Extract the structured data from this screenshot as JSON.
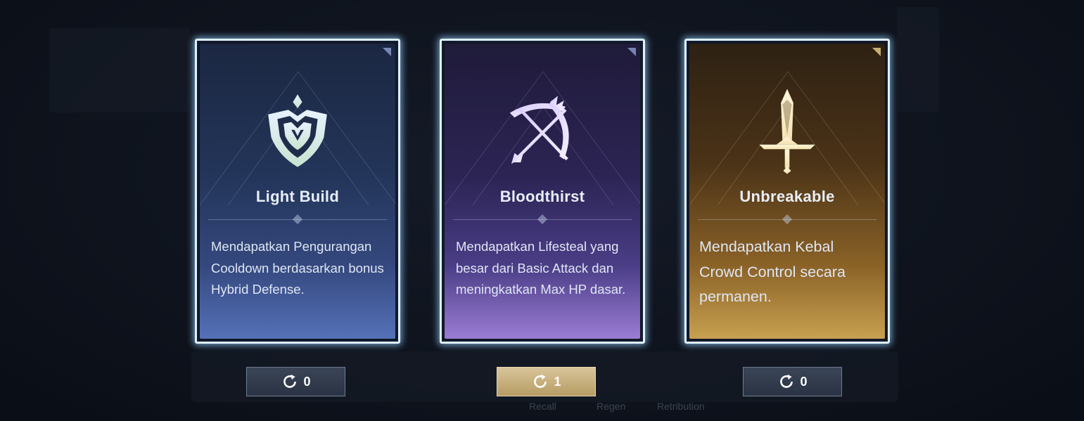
{
  "cards": [
    {
      "title": "Light Build",
      "description": "Mendapatkan Pengurangan Cooldown berdasarkan bonus Hybrid Defense.",
      "icon": "shield-icon",
      "theme": "#3a5290"
    },
    {
      "title": "Bloodthirst",
      "description": "Mendapatkan Lifesteal yang besar dari Basic Attack dan meningkatkan Max HP dasar.",
      "icon": "crossed-bow-arrow-icon",
      "theme": "#6b55b0"
    },
    {
      "title": "Unbreakable",
      "description": "Mendapatkan Kebal Crowd Control secara permanen.",
      "icon": "sword-icon",
      "theme": "#a77d3a"
    }
  ],
  "rerolls": [
    {
      "count": "0",
      "icon": "refresh-icon",
      "highlighted": false
    },
    {
      "count": "1",
      "icon": "refresh-icon",
      "highlighted": true
    },
    {
      "count": "0",
      "icon": "refresh-icon",
      "highlighted": false
    }
  ],
  "background": {
    "labels": [
      "Recall",
      "Regen",
      "Retribution"
    ]
  },
  "colors": {
    "card_border": "#dff1ff",
    "reroll_highlight": "#c9b27c"
  }
}
